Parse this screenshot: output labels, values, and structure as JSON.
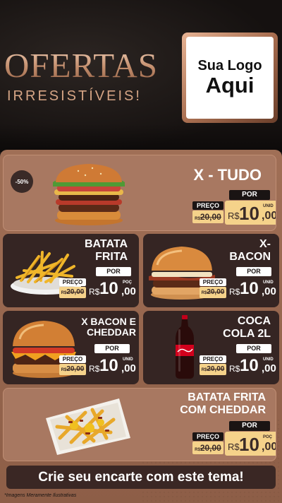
{
  "header": {
    "title": "OFERTAS",
    "subtitle": "IRRESISTÍVEIS!",
    "logo_line1": "Sua Logo",
    "logo_line2": "Aqui"
  },
  "labels": {
    "por": "POR",
    "preco": "PREÇO",
    "rs_small": "R$",
    "rs": "R$"
  },
  "products": [
    {
      "name": "X - TUDO",
      "badge": "-50%",
      "old_price": "20,00",
      "price_int": "10",
      "price_dec": ",00",
      "unit": "UNID"
    },
    {
      "name_l1": "BATATA",
      "name_l2": "FRITA",
      "old_price": "20,00",
      "price_int": "10",
      "price_dec": ",00",
      "unit": "POÇ"
    },
    {
      "name_l1": "X-",
      "name_l2": "BACON",
      "old_price": "20,00",
      "price_int": "10",
      "price_dec": ",00",
      "unit": "UNID"
    },
    {
      "name_l1": "X BACON E",
      "name_l2": "CHEDDAR",
      "old_price": "20,00",
      "price_int": "10",
      "price_dec": ",00",
      "unit": "UNID"
    },
    {
      "name_l1": "COCA",
      "name_l2": "COLA 2L",
      "old_price": "20,00",
      "price_int": "10",
      "price_dec": ",00",
      "unit": "UNID"
    },
    {
      "name_l1": "BATATA FRITA",
      "name_l2": "COM CHEDDAR",
      "old_price": "20,00",
      "price_int": "10",
      "price_dec": ",00",
      "unit": "POÇ"
    }
  ],
  "cta": "Crie seu encarte com este tema!",
  "footnote": "*Imagens Meramente Ilustrativas",
  "colors": {
    "gold": "#f5d28a",
    "dark": "#352523",
    "copper": "#a06f56"
  }
}
